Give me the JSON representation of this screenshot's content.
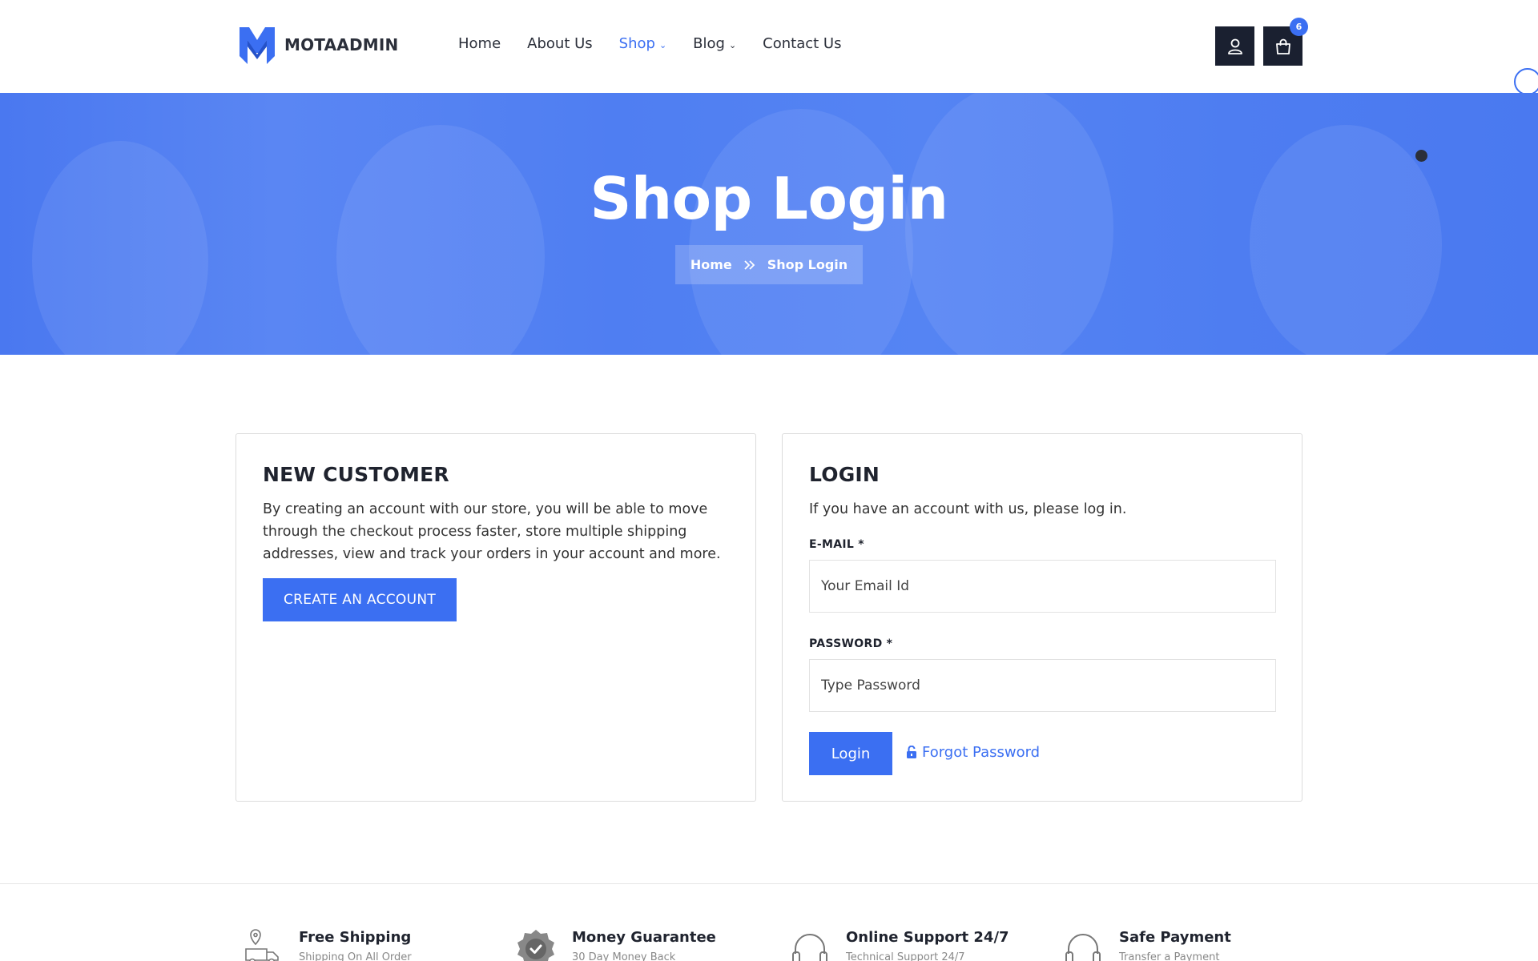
{
  "header": {
    "logo_text": "MOTAADMIN",
    "nav": [
      {
        "label": "Home",
        "active": false,
        "dropdown": false
      },
      {
        "label": "About Us",
        "active": false,
        "dropdown": false
      },
      {
        "label": "Shop",
        "active": true,
        "dropdown": true
      },
      {
        "label": "Blog",
        "active": false,
        "dropdown": true
      },
      {
        "label": "Contact Us",
        "active": false,
        "dropdown": false
      }
    ],
    "user_icon": "user-icon",
    "cart_icon": "shopping-bag-icon",
    "cart_count": "6"
  },
  "banner": {
    "title": "Shop Login",
    "breadcrumb": {
      "home": "Home",
      "separator_icon": "double-chevron-right-icon",
      "current": "Shop Login"
    }
  },
  "new_customer": {
    "heading": "NEW CUSTOMER",
    "text": "By creating an account with our store, you will be able to move through the checkout process faster, store multiple shipping addresses, view and track your orders in your account and more.",
    "button": "CREATE AN ACCOUNT"
  },
  "login": {
    "heading": "LOGIN",
    "intro": "If you have an account with us, please log in.",
    "email_label": "E-MAIL *",
    "email_placeholder": "Your Email Id",
    "password_label": "PASSWORD *",
    "password_placeholder": "Type Password",
    "button": "Login",
    "forgot_icon": "unlock-icon",
    "forgot_label": "Forgot Password"
  },
  "features": [
    {
      "icon": "delivery-truck-icon",
      "title": "Free Shipping",
      "subtitle": "Shipping On All Order"
    },
    {
      "icon": "badge-check-icon",
      "title": "Money Guarantee",
      "subtitle": "30 Day Money Back"
    },
    {
      "icon": "headphones-icon",
      "title": "Online Support 24/7",
      "subtitle": "Technical Support 24/7"
    },
    {
      "icon": "headphones-icon",
      "title": "Safe Payment",
      "subtitle": "Transfer a Payment"
    }
  ],
  "colors": {
    "accent": "#3b6ff2",
    "dark": "#1a2030",
    "banner": "#4f7ef2"
  }
}
